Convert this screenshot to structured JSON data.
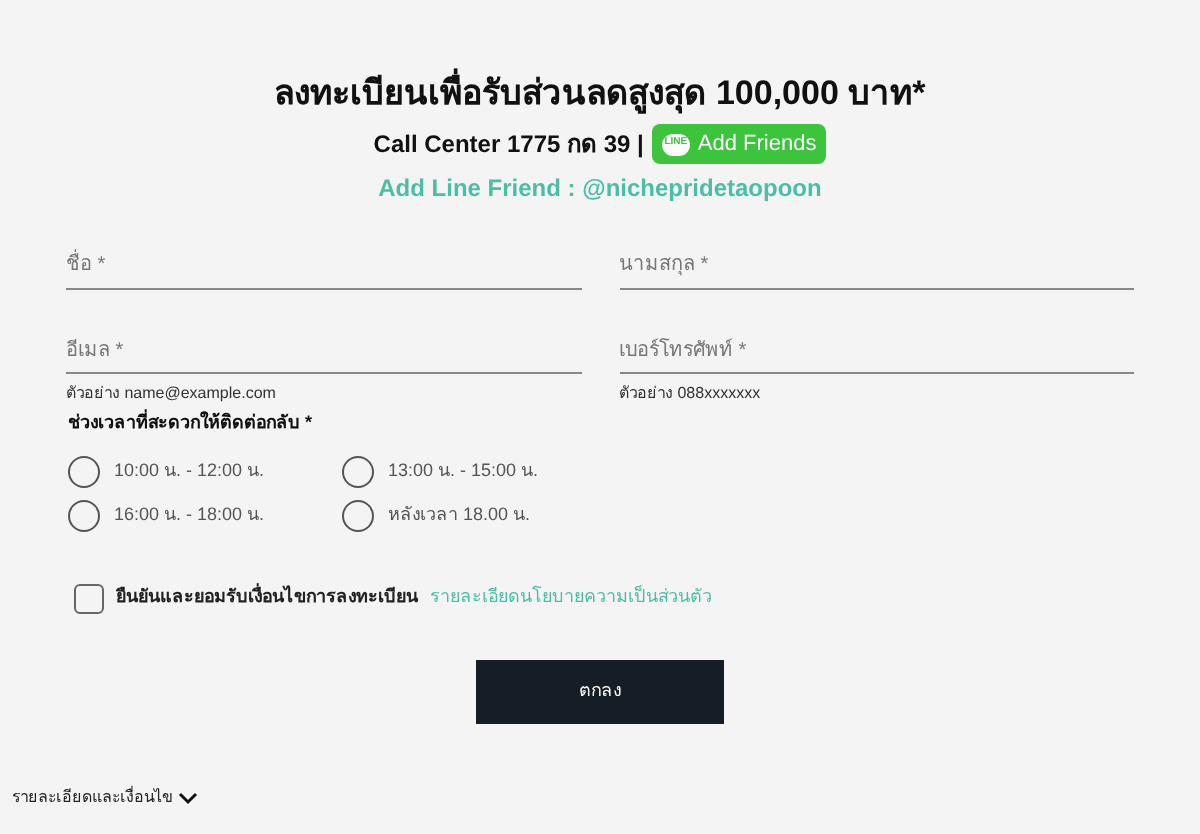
{
  "title": "ลงทะเบียนเพื่อรับส่วนลดสูงสุด 100,000 บาท*",
  "call_center": "Call Center 1775 กด 39 |",
  "line_button": {
    "icon_text": "LINE",
    "label": "Add Friends"
  },
  "line_friend": "Add Line Friend : @nichepridetaopoon",
  "fields": [
    {
      "placeholder": "ชื่อ *"
    },
    {
      "placeholder": "นามสกุล *"
    },
    {
      "placeholder": "อีเมล *",
      "hint": "ตัวอย่าง name@example.com"
    },
    {
      "placeholder": "เบอร์โทรศัพท์ *",
      "hint": "ตัวอย่าง 088xxxxxxx"
    }
  ],
  "time_heading": "ช่วงเวลาที่สะดวกให้ติดต่อกลับ *",
  "time_options": [
    {
      "label": "10:00 น. - 12:00 น.",
      "selected": false
    },
    {
      "label": "13:00 น. - 15:00 น.",
      "selected": false
    },
    {
      "label": "16:00 น. - 18:00 น.",
      "selected": false
    },
    {
      "label": "หลังเวลา 18.00 น.",
      "selected": false
    }
  ],
  "consent": {
    "checked": false,
    "text": "ยืนยันและยอมรับเงื่อนไขการลงทะเบียน",
    "link": "รายละเอียดนโยบายความเป็นส่วนตัว"
  },
  "submit": "ตกลง",
  "footer_toggle": {
    "label": "รายละเอียดและเงื่อนไข",
    "expanded": false
  }
}
